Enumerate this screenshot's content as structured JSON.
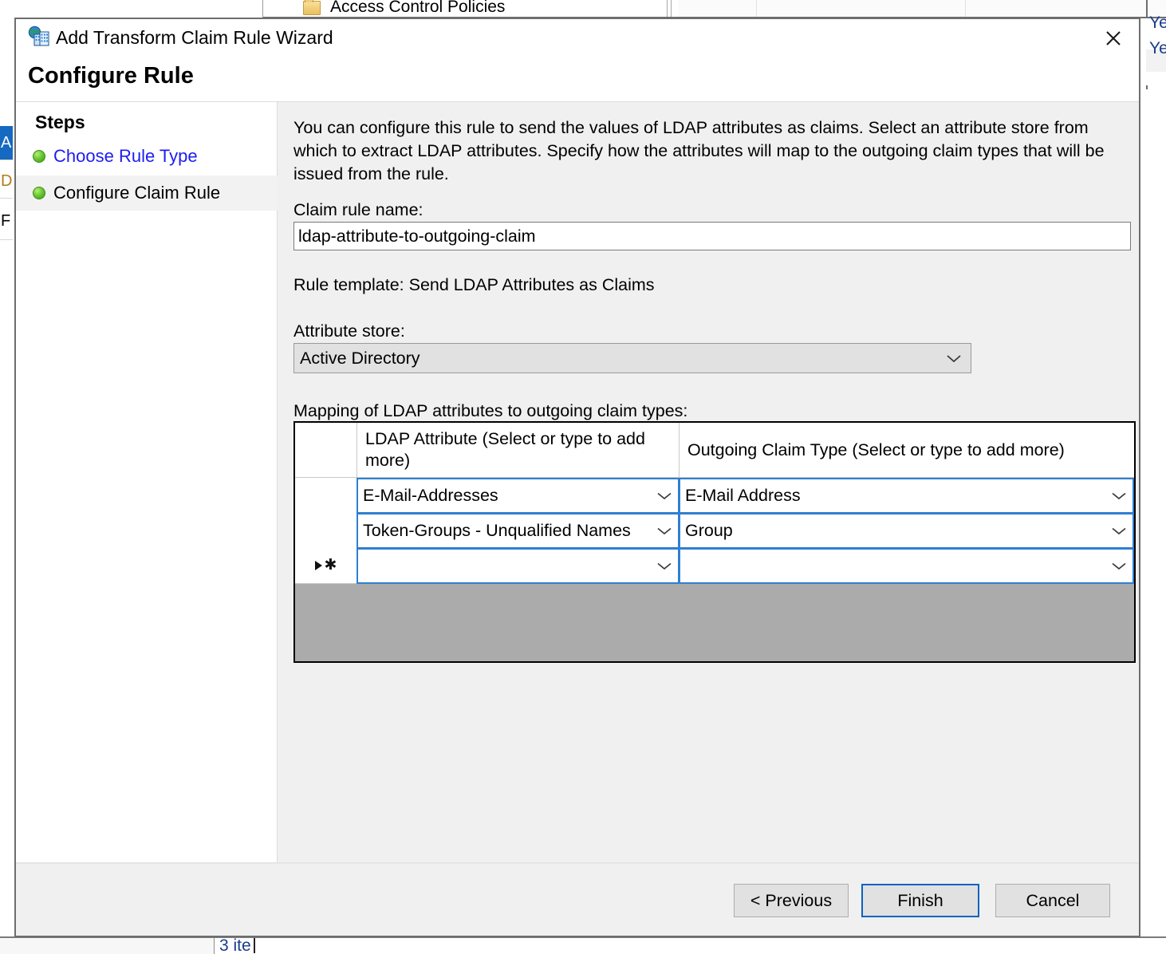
{
  "background": {
    "tree_item_label": "Access Control Policies",
    "tree_fragments": [
      "A",
      "D",
      "F"
    ],
    "selected_fragment": "A",
    "right_column_values": [
      "Ye",
      "Ye"
    ],
    "status_text": "3 ite"
  },
  "dialog": {
    "title": "Add Transform Claim Rule Wizard",
    "title_icon": "adfs-trust-icon",
    "close_label": "Close",
    "page_heading": "Configure Rule"
  },
  "sidebar": {
    "heading": "Steps",
    "items": [
      {
        "label": "Choose Rule Type",
        "state": "link"
      },
      {
        "label": "Configure Claim Rule",
        "state": "active"
      }
    ]
  },
  "content": {
    "intro": "You can configure this rule to send the values of LDAP attributes as claims. Select an attribute store from which to extract LDAP attributes. Specify how the attributes will map to the outgoing claim types that will be issued from the rule.",
    "claim_rule_name_label": "Claim rule name:",
    "claim_rule_name_value": "ldap-attribute-to-outgoing-claim",
    "claim_rule_name_placeholder": "",
    "rule_template_text": "Rule template: Send LDAP Attributes as Claims",
    "attribute_store_label": "Attribute store:",
    "attribute_store_value": "Active Directory",
    "mapping_label": "Mapping of LDAP attributes to outgoing claim types:"
  },
  "grid": {
    "columns": [
      "LDAP Attribute (Select or type to add more)",
      "Outgoing Claim Type (Select or type to add more)"
    ],
    "rows": [
      {
        "ldap_attribute": "E-Mail-Addresses",
        "outgoing_claim_type": "E-Mail Address",
        "marker": ""
      },
      {
        "ldap_attribute": "Token-Groups - Unqualified Names",
        "outgoing_claim_type": "Group",
        "marker": ""
      },
      {
        "ldap_attribute": "",
        "outgoing_claim_type": "",
        "marker": "new-row"
      }
    ]
  },
  "footer": {
    "previous_label": "< Previous",
    "finish_label": "Finish",
    "cancel_label": "Cancel"
  },
  "colors": {
    "accent": "#0078d7",
    "focus_border": "#0a64c2",
    "cell_border": "#2f7fd1",
    "link": "#1d1df0",
    "step_bullet": "#6bc832",
    "grid_empty": "#ababab",
    "dialog_bg": "#f0f0f0"
  }
}
